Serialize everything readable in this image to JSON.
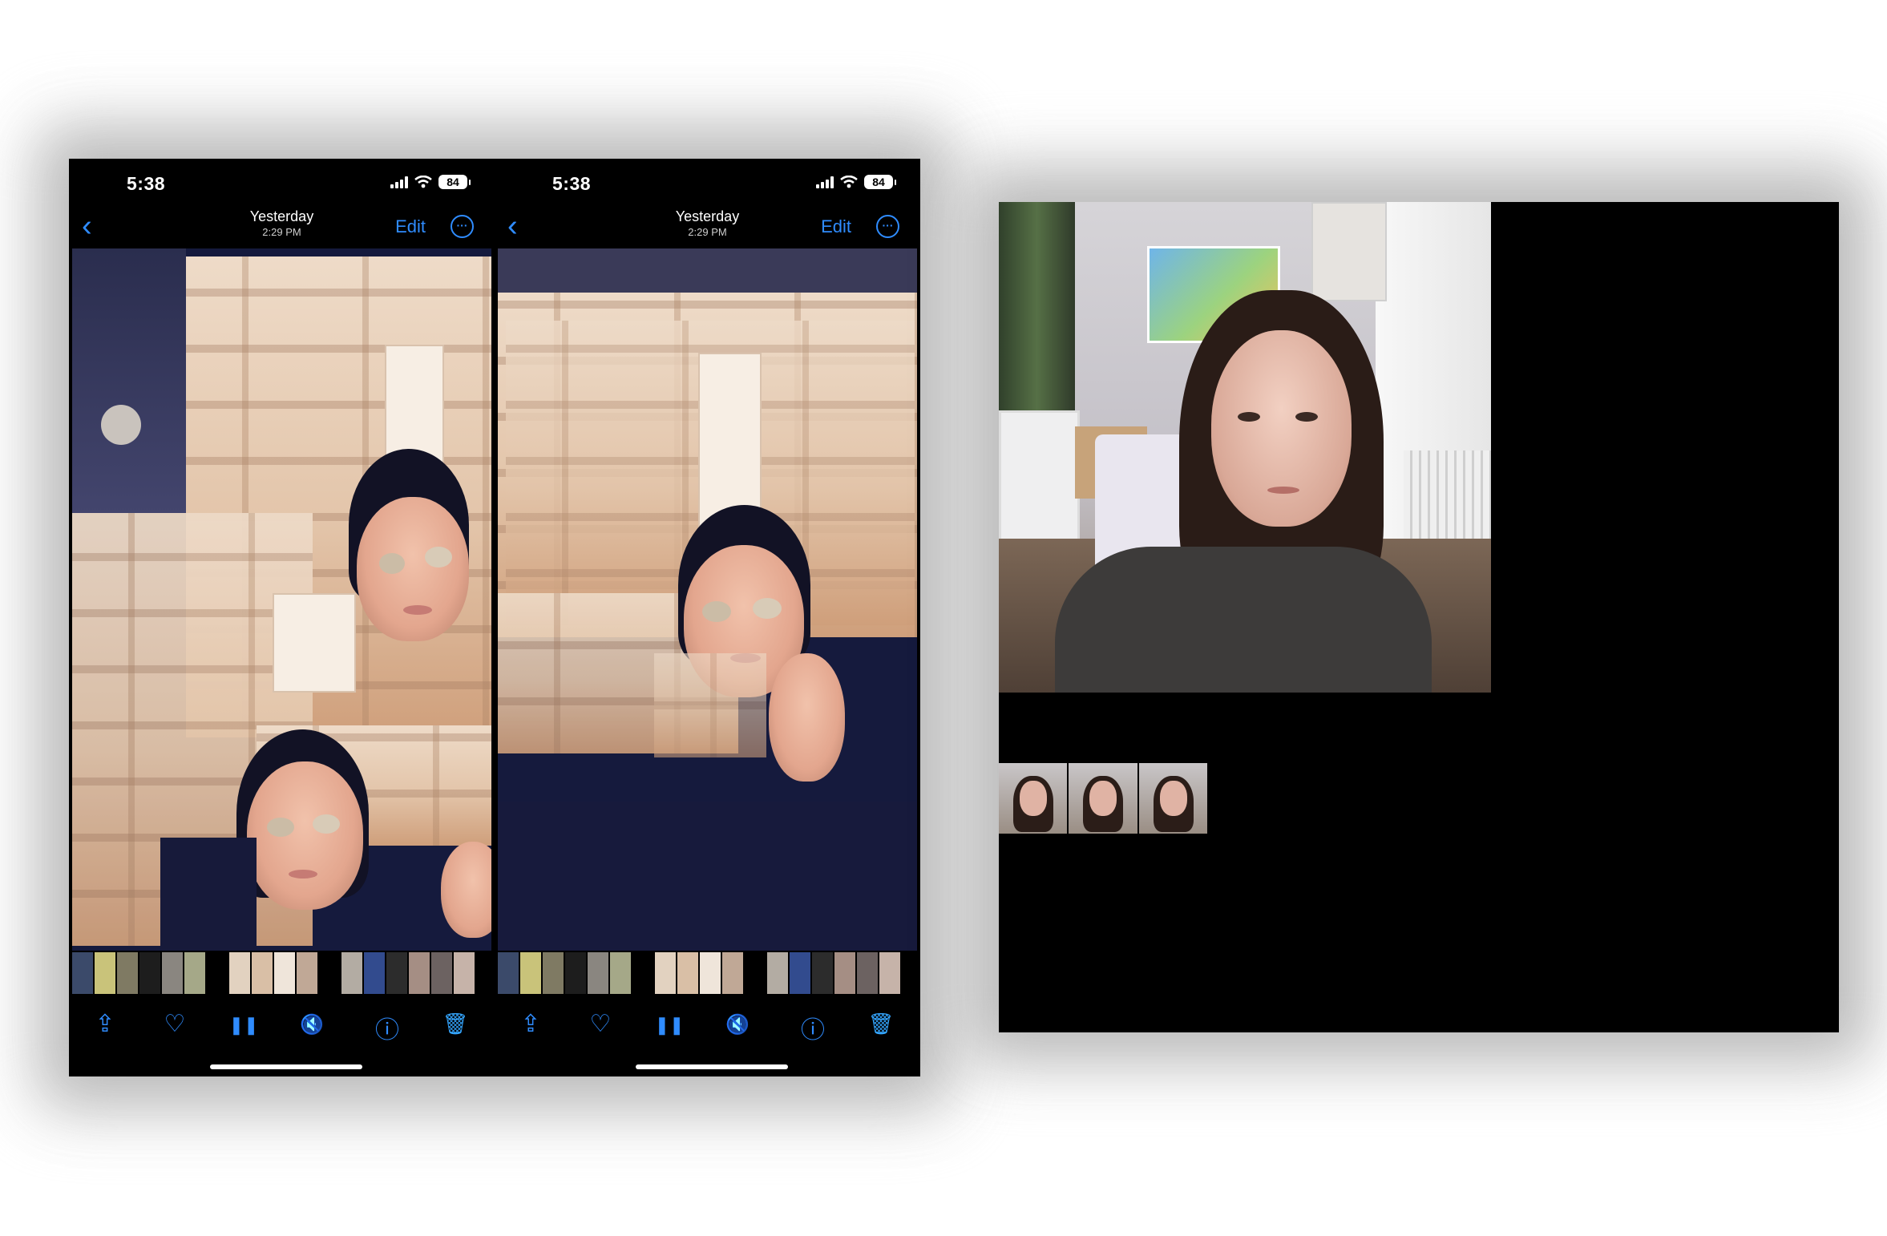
{
  "phones": [
    {
      "status": {
        "time": "5:38",
        "battery": "84"
      },
      "nav": {
        "back": "‹",
        "date": "Yesterday",
        "time": "2:29 PM",
        "edit": "Edit",
        "more": "···"
      },
      "toolbar": {
        "share": "⇪",
        "favorite": "♡",
        "pause": "❚❚",
        "mute": "🔇",
        "info": "ⓘ",
        "delete": "🗑"
      }
    },
    {
      "status": {
        "time": "5:38",
        "battery": "84"
      },
      "nav": {
        "back": "‹",
        "date": "Yesterday",
        "time": "2:29 PM",
        "edit": "Edit",
        "more": "···"
      },
      "toolbar": {
        "share": "⇪",
        "favorite": "♡",
        "pause": "❚❚",
        "mute": "🔇",
        "info": "ⓘ",
        "delete": "🗑"
      }
    }
  ],
  "colors": {
    "accent": "#2f8cff",
    "background": "#000000"
  },
  "icons": [
    "back-chevron-icon",
    "more-icon",
    "share-icon",
    "heart-icon",
    "pause-icon",
    "mute-icon",
    "info-icon",
    "trash-icon",
    "signal-icon",
    "wifi-icon",
    "battery-icon"
  ]
}
